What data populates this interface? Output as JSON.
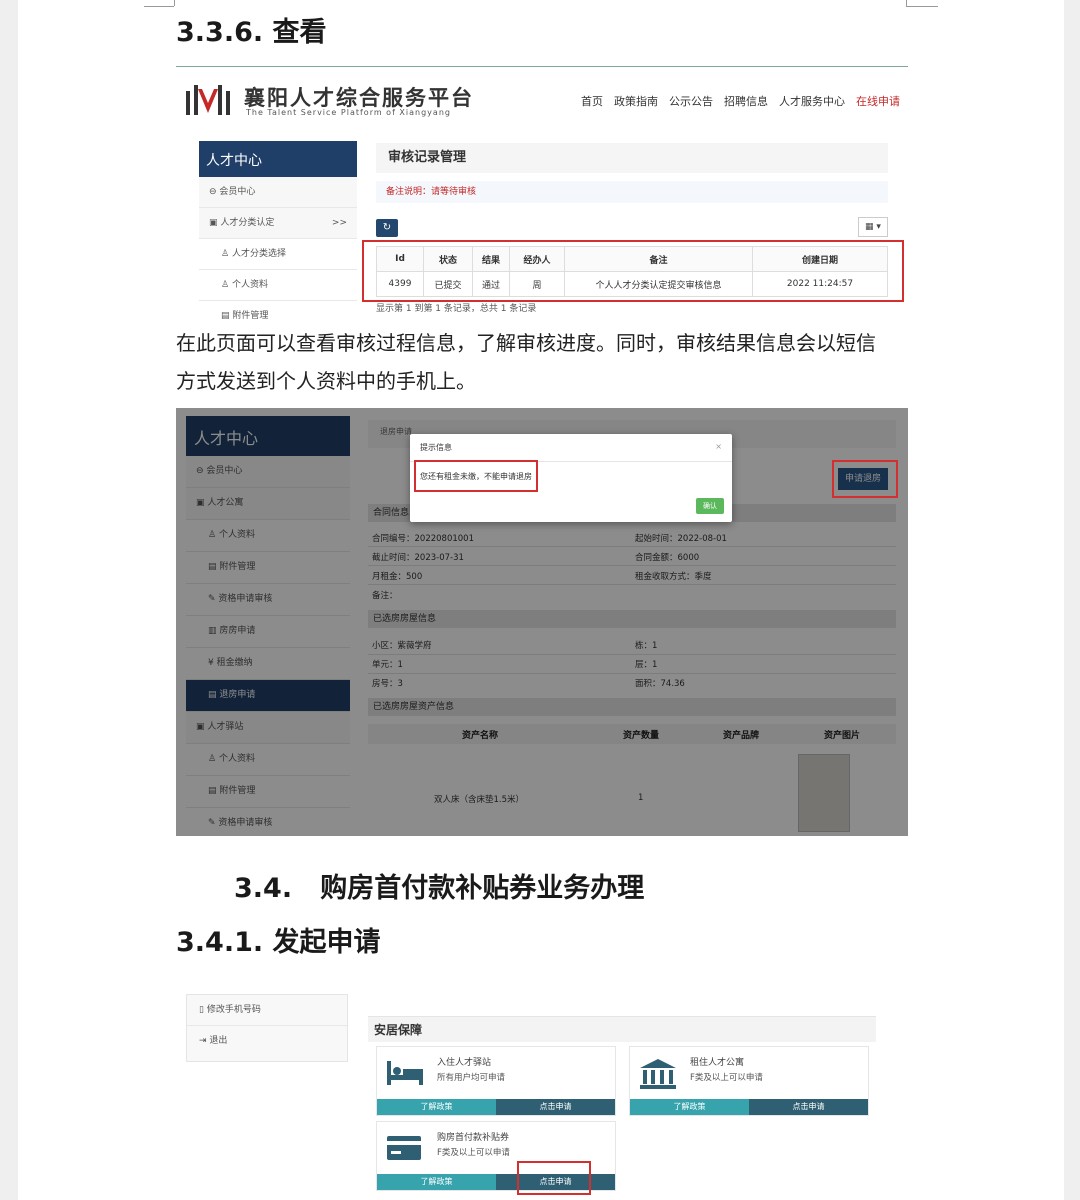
{
  "headings": {
    "h336": "3.3.6. 查看",
    "h34": "3.4.   购房首付款补贴券业务办理",
    "h341": "3.4.1. 发起申请"
  },
  "paragraph": {
    "line1": "在此页面可以查看审核过程信息，了解审核进度。同时，审核结果信息会以短信",
    "line2": "方式发送到个人资料中的手机上。"
  },
  "shot1": {
    "brand": "襄阳人才综合服务平台",
    "brand_en": "The Talent Service Platform of Xiangyang",
    "nav": [
      "首页",
      "政策指南",
      "公示公告",
      "招聘信息",
      "人才服务中心",
      "在线申请"
    ],
    "sidebar": {
      "title": "人才中心",
      "items": [
        "会员中心",
        "人才分类认定",
        "人才分类选择",
        "个人资料",
        "附件管理"
      ],
      "expand": ">>"
    },
    "main_title": "审核记录管理",
    "notice_label": "备注说明：",
    "notice_value": "请等待审核",
    "refresh_glyph": "↻",
    "grid_glyph": "▦ ▾",
    "table": {
      "headers": [
        "Id",
        "状态",
        "结果",
        "经办人",
        "备注",
        "创建日期"
      ],
      "row": [
        "4399",
        "已提交",
        "通过",
        "周",
        "个人人才分类认定提交审核信息",
        "2022 11:24:57"
      ]
    },
    "footer": "显示第 1 到第 1 条记录，总共 1 条记录"
  },
  "shot2": {
    "sidebar": {
      "title": "人才中心",
      "items": [
        "会员中心",
        "人才公寓",
        "个人资料",
        "附件管理",
        "资格申请审核",
        "房房申请",
        "租金缴纳",
        "退房申请",
        "人才驿站",
        "个人资料",
        "附件管理",
        "资格申请审核"
      ]
    },
    "crumb": "退房申请",
    "apply_button": "申请退房",
    "modal": {
      "title": "提示信息",
      "close": "×",
      "message": "您还有租金未缴，不能申请退房",
      "ok": "确认"
    },
    "contract_section": "合同信息",
    "contract": {
      "no": "合同编号：20220801001",
      "start": "起始时间：2022-08-01",
      "end": "截止时间：2023-07-31",
      "total": "合同金额：6000",
      "monthly": "月租金：500",
      "pay_mode": "租金收取方式：季度",
      "remark": "备注："
    },
    "room_section": "已选房房屋信息",
    "room": {
      "community": "小区：紫薇学府",
      "building": "栋：1",
      "unit": "单元：1",
      "floor": "层：1",
      "room_no": "房号：3",
      "area": "面积：74.36"
    },
    "asset_section": "已选房房屋资产信息",
    "asset_headers": [
      "资产名称",
      "资产数量",
      "资产品牌",
      "资产图片"
    ],
    "asset_row": [
      "双人床（含床垫1.5米）",
      "1",
      ""
    ]
  },
  "shot3": {
    "menu": [
      "修改手机号码",
      "退出"
    ],
    "title": "安居保障",
    "cards": [
      {
        "title": "入住人才驿站",
        "sub": "所有用户均可申请",
        "btn1": "了解政策",
        "btn2": "点击申请"
      },
      {
        "title": "租住人才公寓",
        "sub": "F类及以上可以申请",
        "btn1": "了解政策",
        "btn2": "点击申请"
      },
      {
        "title": "购房首付款补贴券",
        "sub": "F类及以上可以申请",
        "btn1": "了解政策",
        "btn2": "点击申请"
      }
    ]
  },
  "colors": {
    "navy": "#1f3e68",
    "highlight_red": "#d32f2f",
    "teal": "#37a3ad",
    "dark_teal": "#2f5f73"
  }
}
